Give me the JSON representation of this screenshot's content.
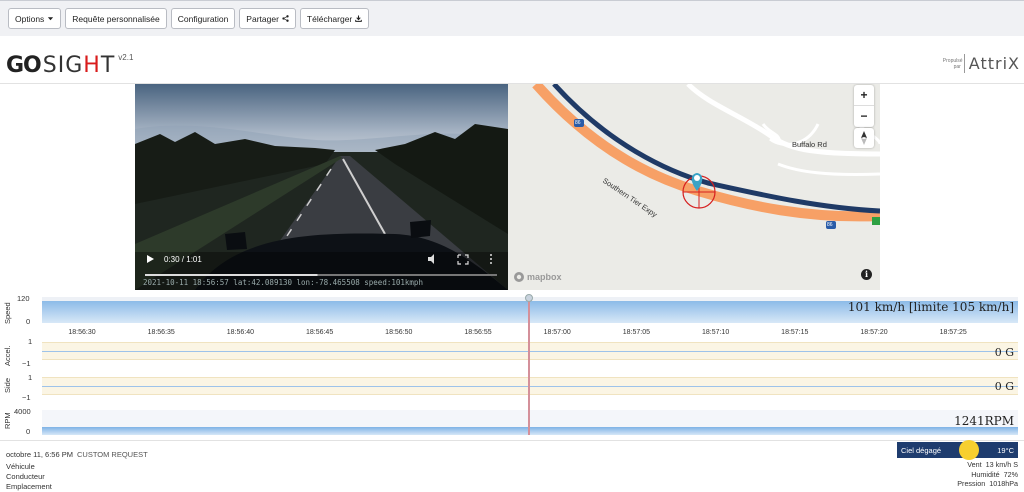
{
  "toolbar": {
    "options": "Options",
    "custom_request": "Requête personnalisée",
    "configuration": "Configuration",
    "share": "Partager",
    "download": "Télécharger"
  },
  "brand": {
    "mark": "GO",
    "word_pre": "SIG",
    "word_mid": "H",
    "word_post": "T",
    "version": "v2.1",
    "powered_1": "Propulsé",
    "powered_2": "par",
    "partner": "AttriX"
  },
  "video": {
    "time": "0:30 / 1:01",
    "progress": 0.49,
    "overlay": "2021-10-11 18:56:57 lat:42.089130 lon:-78.465508 speed:101kmph"
  },
  "map": {
    "road_label": "Southern Tier Expy",
    "street_label": "Buffalo Rd",
    "shield_1": "86",
    "shield_2": "86",
    "zoom_in": "+",
    "zoom_out": "−",
    "attribution": "mapbox",
    "info": "i"
  },
  "charts": {
    "speed": {
      "label": "Speed",
      "max": "120",
      "min": "0",
      "readout": "101 km/h [limite 105 km/h]",
      "value": 101,
      "limit": 105
    },
    "accel": {
      "label": "Accel.",
      "max": "1",
      "min": "−1",
      "readout": "0 G"
    },
    "side": {
      "label": "Side",
      "max": "1",
      "min": "−1",
      "readout": "0 G"
    },
    "rpm": {
      "label": "RPM",
      "max": "4000",
      "min": "0",
      "readout": "1241RPM",
      "value": 1241
    },
    "x_ticks": [
      "18:56:30",
      "18:56:35",
      "18:56:40",
      "18:56:45",
      "18:56:50",
      "18:56:55",
      "18:57:00",
      "18:57:05",
      "18:57:10",
      "18:57:15",
      "18:57:20",
      "18:57:25"
    ]
  },
  "footer": {
    "datetime": "octobre 11, 6:56 PM",
    "request": "CUSTOM REQUEST",
    "vehicle": "Véhicule",
    "driver": "Conducteur",
    "location": "Emplacement"
  },
  "weather": {
    "condition": "Ciel dégagé",
    "temp": "19°C",
    "wind_label": "Vent",
    "wind": "13 km/h S",
    "humidity_label": "Humidité",
    "humidity": "72%",
    "pressure_label": "Pression",
    "pressure": "1018hPa"
  },
  "colors": {
    "speed_fill": "#4a90d9",
    "weather_bg": "#1e3c6e",
    "road": "#f7a066",
    "route": "#1f3a66"
  }
}
